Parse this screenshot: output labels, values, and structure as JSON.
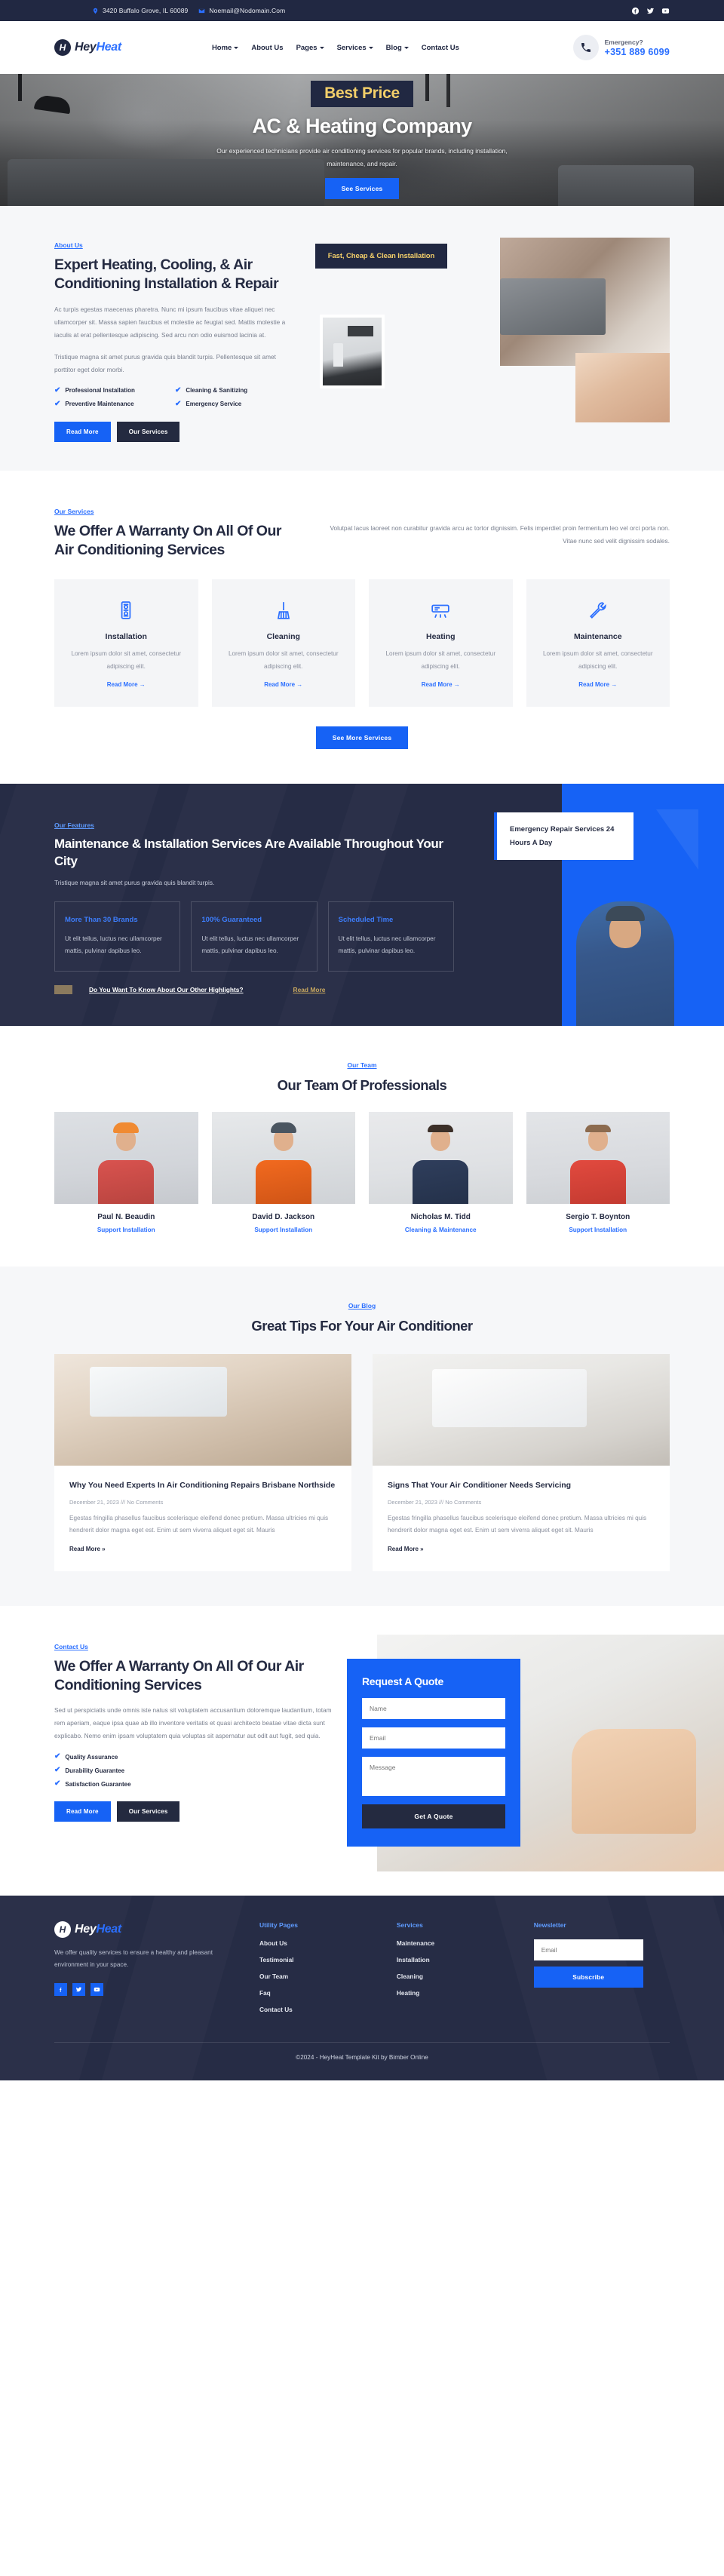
{
  "topbar": {
    "address": "3420 Buffalo Grove, IL 60089",
    "email": "Noemail@Nodomain.Com",
    "social": [
      "facebook-icon",
      "twitter-icon",
      "youtube-icon"
    ]
  },
  "nav": {
    "brand_part1": "Hey",
    "brand_part2": "Heat",
    "brand_mark": "H",
    "items": [
      {
        "label": "Home",
        "has_caret": true
      },
      {
        "label": "About Us",
        "has_caret": false
      },
      {
        "label": "Pages",
        "has_caret": true
      },
      {
        "label": "Services",
        "has_caret": true
      },
      {
        "label": "Blog",
        "has_caret": true
      },
      {
        "label": "Contact Us",
        "has_caret": false
      }
    ],
    "emergency_label": "Emergency?",
    "emergency_phone": "+351 889 6099"
  },
  "hero": {
    "badge": "Best Price",
    "title": "AC & Heating Company",
    "subtitle": "Our experienced technicians provide air conditioning services for popular brands, including installation, maintenance, and repair.",
    "button": "See Services"
  },
  "about": {
    "eyebrow": "About Us",
    "title": "Expert Heating, Cooling, & Air Conditioning Installation & Repair",
    "p1": "Ac turpis egestas maecenas pharetra. Nunc mi ipsum faucibus vitae aliquet nec ullamcorper sit. Massa sapien faucibus et molestie ac feugiat sed. Mattis molestie a iaculis at erat pellentesque adipiscing. Sed arcu non odio euismod lacinia at.",
    "p2": "Tristique magna sit amet purus gravida quis blandit turpis. Pellentesque sit amet porttitor eget dolor morbi.",
    "checks": [
      "Professional Installation",
      "Cleaning & Sanitizing",
      "Preventive Maintenance",
      "Emergency Service"
    ],
    "btn_primary": "Read More",
    "btn_dark": "Our Services",
    "image_badge": "Fast, Cheap & Clean Installation"
  },
  "services": {
    "eyebrow": "Our Services",
    "title": "We Offer A Warranty On All Of Our Air Conditioning Services",
    "intro": "Volutpat lacus laoreet non curabitur gravida arcu ac tortor dignissim. Felis imperdiet proin fermentum leo vel orci porta non. Vitae nunc sed velit dignissim sodales.",
    "cards": [
      {
        "icon": "ac-unit-icon",
        "title": "Installation",
        "desc": "Lorem ipsum dolor sit amet, consectetur adipiscing elit.",
        "link": "Read More  →"
      },
      {
        "icon": "broom-icon",
        "title": "Cleaning",
        "desc": "Lorem ipsum dolor sit amet, consectetur adipiscing elit.",
        "link": "Read More  →"
      },
      {
        "icon": "heater-icon",
        "title": "Heating",
        "desc": "Lorem ipsum dolor sit amet, consectetur adipiscing elit.",
        "link": "Read More  →"
      },
      {
        "icon": "wrench-icon",
        "title": "Maintenance",
        "desc": "Lorem ipsum dolor sit amet, consectetur adipiscing elit.",
        "link": "Read More  →"
      }
    ],
    "cta": "See More Services"
  },
  "features": {
    "eyebrow": "Our Features",
    "title": "Maintenance & Installation Services Are Available Throughout Your City",
    "subtitle": "Tristique magna sit amet purus gravida quis blandit turpis.",
    "cards": [
      {
        "title": "More Than 30 Brands",
        "desc": "Ut elit tellus, luctus nec ullamcorper mattis, pulvinar dapibus leo."
      },
      {
        "title": "100% Guaranteed",
        "desc": "Ut elit tellus, luctus nec ullamcorper mattis, pulvinar dapibus leo."
      },
      {
        "title": "Scheduled Time",
        "desc": "Ut elit tellus, luctus nec ullamcorper mattis, pulvinar dapibus leo."
      }
    ],
    "question": "Do You Want To Know About Our Other Highlights?",
    "read_more": "Read More",
    "badge": "Emergency Repair Services 24 Hours A Day"
  },
  "team": {
    "eyebrow": "Our Team",
    "title": "Our Team Of Professionals",
    "members": [
      {
        "name": "Paul N. Beaudin",
        "role": "Support Installation"
      },
      {
        "name": "David D. Jackson",
        "role": "Support Installation"
      },
      {
        "name": "Nicholas M. Tidd",
        "role": "Cleaning & Maintenance"
      },
      {
        "name": "Sergio T. Boynton",
        "role": "Support Installation"
      }
    ]
  },
  "blog": {
    "eyebrow": "Our Blog",
    "title": "Great Tips For Your Air Conditioner",
    "posts": [
      {
        "title": "Why You Need Experts In Air Conditioning Repairs Brisbane Northside",
        "meta": "December 21, 2023 /// No Comments",
        "text": "Egestas fringilla phasellus faucibus scelerisque eleifend donec pretium. Massa ultricies mi quis hendrerit dolor magna eget est. Enim ut sem viverra aliquet eget sit. Mauris",
        "link": "Read More »"
      },
      {
        "title": "Signs That Your Air Conditioner Needs Servicing",
        "meta": "December 21, 2023 /// No Comments",
        "text": "Egestas fringilla phasellus faucibus scelerisque eleifend donec pretium. Massa ultricies mi quis hendrerit dolor magna eget est. Enim ut sem viverra aliquet eget sit. Mauris",
        "link": "Read More »"
      }
    ]
  },
  "contact": {
    "eyebrow": "Contact Us",
    "title": "We Offer A Warranty On All Of Our Air Conditioning Services",
    "text": "Sed ut perspiciatis unde omnis iste natus sit voluptatem accusantium doloremque laudantium, totam rem aperiam, eaque ipsa quae ab illo inventore veritatis et quasi architecto beatae vitae dicta sunt explicabo. Nemo enim ipsam voluptatem quia voluptas sit aspernatur aut odit aut fugit, sed quia.",
    "checks": [
      "Quality Assurance",
      "Durability Guarantee",
      "Satisfaction Guarantee"
    ],
    "btn_primary": "Read More",
    "btn_dark": "Our Services",
    "form": {
      "title": "Request A Quote",
      "name_placeholder": "Name",
      "email_placeholder": "Email",
      "message_placeholder": "Message",
      "submit": "Get A Quote"
    }
  },
  "footer": {
    "brand_part1": "Hey",
    "brand_part2": "Heat",
    "brand_mark": "H",
    "description": "We offer quality services to ensure a healthy and pleasant environment in your space.",
    "col1_title": "Utility Pages",
    "col1_links": [
      "About Us",
      "Testimonial",
      "Our Team",
      "Faq",
      "Contact Us"
    ],
    "col2_title": "Services",
    "col2_links": [
      "Maintenance",
      "Installation",
      "Cleaning",
      "Heating"
    ],
    "news_title": "Newsletter",
    "news_placeholder": "Email",
    "news_button": "Subscribe",
    "copyright": "©2024 - HeyHeat Template Kit by Bimber Online"
  },
  "colors": {
    "accent": "#1662f5",
    "dark": "#262c45",
    "topbar": "#212842",
    "gold": "#f3cf6a"
  }
}
